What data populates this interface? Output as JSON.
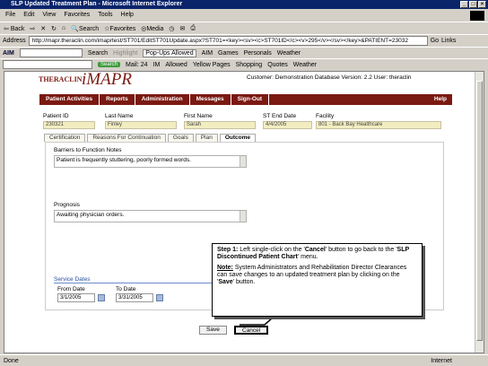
{
  "window": {
    "title": "SLP Updated Treatment Plan - Microsoft Internet Explorer"
  },
  "menu": [
    "File",
    "Edit",
    "View",
    "Favorites",
    "Tools",
    "Help"
  ],
  "toolbar": {
    "back": "Back",
    "search": "Search",
    "favorites": "Favorites",
    "media": "Media"
  },
  "address": {
    "label": "Address",
    "url": "http://mapr.theraclin.com/imaprtest/ST701/EditST701Update.aspx?ST701=<key><sv><c>ST701ID</c><v>295</v></sv></key>&PATIENT=23032",
    "go": "Go",
    "links": "Links"
  },
  "aimbar": {
    "aim": "AIM",
    "search": "Search",
    "highlight": "Highlight",
    "popups": "Pop-Ups Allowed",
    "aim2": "AIM",
    "games": "Games",
    "personals": "Personals",
    "weather": "Weather"
  },
  "yahoobar": {
    "search": "Search",
    "mail": "Mail: 24",
    "im": "IM",
    "allowed": "Allowed",
    "yellow": "Yellow Pages",
    "shopping": "Shopping",
    "quotes": "Quotes",
    "weather": "Weather"
  },
  "app": {
    "logo_left": "THERACLIN",
    "logo_right": "iMAPR",
    "customer": "Customer: Demonstration Database Version: 2.2 User: theraclin"
  },
  "nav": [
    "Patient Activities",
    "Reports",
    "Administration",
    "Messages",
    "Sign-Out"
  ],
  "nav_help": "Help",
  "patient": {
    "id_label": "Patient ID",
    "id": "230321",
    "last_label": "Last Name",
    "last": "Finley",
    "first_label": "First Name",
    "first": "Sarah",
    "end_label": "ST End Date",
    "end": "4/4/2005",
    "facility_label": "Facility",
    "facility": "801 - Back Bay Healthcare"
  },
  "tabs": [
    "Certification",
    "Reasons For Continuation",
    "Goals",
    "Plan",
    "Outcome"
  ],
  "outcome": {
    "barriers_label": "Barriers to Function Notes",
    "barriers": "Patient is frequently stuttering, poorly formed words.",
    "prognosis_label": "Prognosis",
    "prognosis": "Awaiting physician orders."
  },
  "service": {
    "label": "Service Dates",
    "from_label": "From Date",
    "from": "3/1/2005",
    "to_label": "To Date",
    "to": "3/31/2005"
  },
  "buttons": {
    "save": "Save",
    "cancel": "Cancel"
  },
  "callout": {
    "step": "Step 1:",
    "line1": " Left single-click on the '",
    "cancel": "Cancel",
    "line2": "' button to go back to the '",
    "menu": "SLP Discontinued Patient Chart",
    "line3": "' menu.",
    "note": "Note:",
    "note_text": " System Administrators and Rehabilitation Director Clearances can save changes to an updated treatment plan by clicking on the '",
    "save": "Save",
    "note_end": "' button."
  },
  "status": {
    "left": "Done",
    "right": "Internet"
  }
}
